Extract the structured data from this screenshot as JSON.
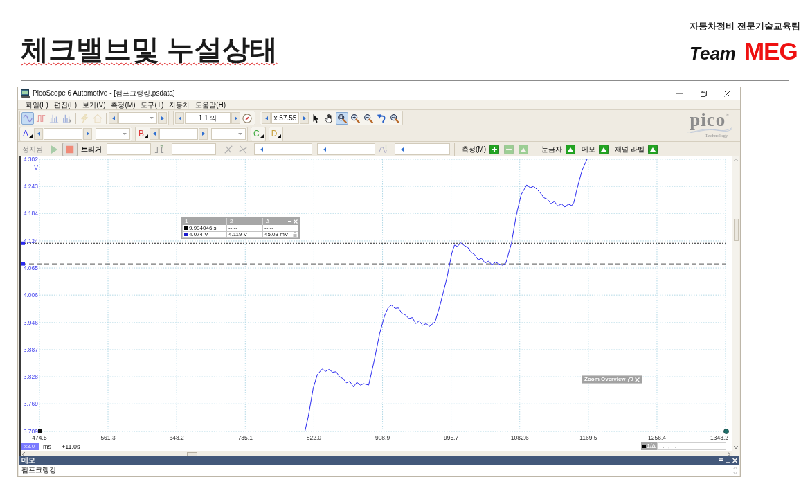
{
  "slide": {
    "title": "체크밸브및 누설상태",
    "spell_flagged": true,
    "organization": "자동차정비 전문기술교육팀",
    "brand_word": "Team",
    "brand_name": "MEG"
  },
  "window": {
    "title": "PicoScope 6 Automotive - [펌프크랭킹.psdata]"
  },
  "menu": [
    "파일(F)",
    "편집(E)",
    "보기(V)",
    "측정(M)",
    "도구(T)",
    "자동차",
    "도움말(H)"
  ],
  "toolbar": {
    "view_modes": [
      {
        "kind": "scope",
        "selected": true
      },
      {
        "kind": "persistence",
        "selected": false
      },
      {
        "kind": "spectrum",
        "selected": false
      },
      {
        "kind": "spectrum-add",
        "selected": false
      }
    ],
    "actions": [
      {
        "kind": "wand",
        "disabled": true
      },
      {
        "kind": "home",
        "disabled": true
      }
    ],
    "buffer": "1 1 의",
    "zoom": "x 57.55",
    "tools": [
      {
        "kind": "pointer",
        "selected": false
      },
      {
        "kind": "hand",
        "selected": false
      },
      {
        "kind": "zoom-box",
        "selected": true
      },
      {
        "kind": "zoom-in",
        "selected": false
      },
      {
        "kind": "zoom-out",
        "selected": false
      },
      {
        "kind": "undo",
        "selected": false
      },
      {
        "kind": "zoom-fit",
        "selected": false
      }
    ]
  },
  "logo": {
    "name": "pico$^{®}$",
    "tagline": "Technology"
  },
  "channels": [
    {
      "letter": "A",
      "color": "#3333ee",
      "kind": "full"
    },
    {
      "letter": "B",
      "color": "#e03a3a",
      "kind": "full"
    },
    {
      "letter": "C",
      "color": "#38a838",
      "kind": "compact"
    },
    {
      "letter": "D",
      "color": "#c9a13c",
      "kind": "compact"
    }
  ],
  "capture": {
    "status": "정지됨",
    "running": false,
    "trigger_label": "트리거"
  },
  "measurements": {
    "label": "측정(M)",
    "buttons": [
      {
        "kind": "add",
        "disabled": false
      },
      {
        "kind": "remove",
        "disabled": true
      },
      {
        "kind": "edit",
        "disabled": true
      }
    ]
  },
  "overlays": [
    {
      "label": "눈금자",
      "on": true
    },
    {
      "label": "메모",
      "on": true
    },
    {
      "label": "채널 라벨",
      "on": true
    }
  ],
  "plot": {
    "chart_data": {
      "type": "line",
      "ylabel": "V",
      "x": [
        810.6,
        815.0,
        821.1,
        826.4,
        832.5,
        836.9,
        841.3,
        845.7,
        850.1,
        854.5,
        858.8,
        863.2,
        867.6,
        872.0,
        876.4,
        880.8,
        885.2,
        891.3,
        898.3,
        905.3,
        911.5,
        915.9,
        920.2,
        924.6,
        929.0,
        933.4,
        937.8,
        942.2,
        946.6,
        951.0,
        955.3,
        959.7,
        964.1,
        968.5,
        975.5,
        981.7,
        990.5,
        996.6,
        1000.0,
        1003.6,
        1008.0,
        1012.4,
        1016.8,
        1021.2,
        1025.6,
        1029.9,
        1034.3,
        1038.7,
        1043.1,
        1047.5,
        1051.9,
        1056.3,
        1060.7,
        1065.1,
        1072.1,
        1078.2,
        1084.4,
        1091.4,
        1095.8,
        1100.2,
        1104.6,
        1109.0,
        1113.4,
        1117.7,
        1122.1,
        1126.5,
        1131.0,
        1135.4,
        1139.7,
        1144.1,
        1148.5,
        1151.1,
        1155.5,
        1161.6,
        1167.8
      ],
      "series": [
        {
          "color": "#2a2af0",
          "values": [
            3.709,
            3.742,
            3.803,
            3.833,
            3.845,
            3.84,
            3.844,
            3.838,
            3.839,
            3.828,
            3.824,
            3.815,
            3.818,
            3.806,
            3.816,
            3.81,
            3.813,
            3.81,
            3.863,
            3.923,
            3.961,
            3.978,
            3.984,
            3.977,
            3.978,
            3.966,
            3.963,
            3.955,
            3.957,
            3.944,
            3.95,
            3.94,
            3.944,
            3.938,
            3.948,
            3.984,
            4.044,
            4.097,
            4.115,
            4.112,
            4.12,
            4.114,
            4.11,
            4.099,
            4.094,
            4.083,
            4.086,
            4.076,
            4.08,
            4.072,
            4.078,
            4.074,
            4.071,
            4.076,
            4.119,
            4.18,
            4.225,
            4.246,
            4.24,
            4.243,
            4.236,
            4.228,
            4.218,
            4.215,
            4.205,
            4.21,
            4.2,
            4.205,
            4.198,
            4.204,
            4.201,
            4.208,
            4.24,
            4.278,
            4.302
          ]
        }
      ],
      "xlim": [
        474.5,
        1343.2
      ],
      "ylim": [
        3.709,
        4.302
      ],
      "xticks": [
        474.5,
        561.3,
        648.2,
        735.1,
        {
          "value": 822,
          "label": "822.0"
        },
        908.9,
        995.7,
        1082.6,
        1169.5,
        1256.4,
        1343.2
      ],
      "yticks": [
        3.709,
        3.769,
        3.828,
        3.887,
        3.946,
        4.006,
        4.065,
        4.124,
        4.184,
        4.243,
        4.302
      ],
      "grid": true,
      "ref_lines": [
        {
          "axis": "y",
          "value": 4.119
        },
        {
          "axis": "y",
          "value": 4.074
        }
      ]
    },
    "ruler_table": {
      "headers": [
        "1",
        "2",
        "Δ"
      ],
      "rows": [
        {
          "color": "#000000",
          "locked": false,
          "cells": [
            "9.994046 s",
            "--.--",
            "--.--"
          ]
        },
        {
          "color": "#1a1acc",
          "locked": true,
          "cells": [
            "4.074 V",
            "4.119 V",
            "45.03 mV"
          ]
        }
      ]
    },
    "zoom_overview": {
      "title": "Zoom Overview"
    },
    "time_controls": {
      "zoom": "x3.0",
      "unit": "ms",
      "offset": "+11.0s"
    },
    "readout": {
      "label": "1/Δ",
      "value": "--.--, --.--"
    }
  },
  "memo": {
    "title": "메모",
    "text": "펌프크랭킹"
  }
}
